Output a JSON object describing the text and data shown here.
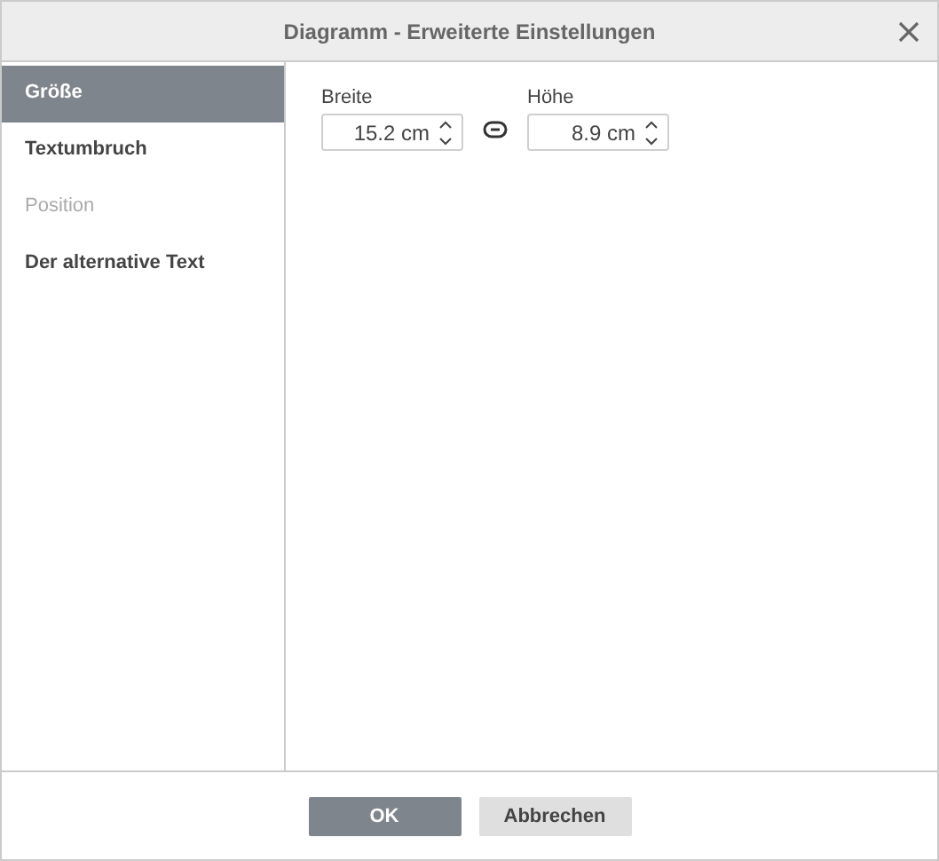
{
  "window": {
    "title": "Diagramm - Erweiterte Einstellungen"
  },
  "sidebar": {
    "items": [
      {
        "label": "Größe",
        "selected": true,
        "disabled": false
      },
      {
        "label": "Textumbruch",
        "selected": false,
        "disabled": false
      },
      {
        "label": "Position",
        "selected": false,
        "disabled": true
      },
      {
        "label": "Der alternative Text",
        "selected": false,
        "disabled": false
      }
    ]
  },
  "fields": [
    {
      "label": "Breite",
      "value": "15.2 cm"
    },
    {
      "label": "Höhe",
      "value": "8.9 cm"
    }
  ],
  "buttons": [
    {
      "label": "OK",
      "kind": "primary"
    },
    {
      "label": "Abbrechen",
      "kind": "secondary"
    }
  ]
}
